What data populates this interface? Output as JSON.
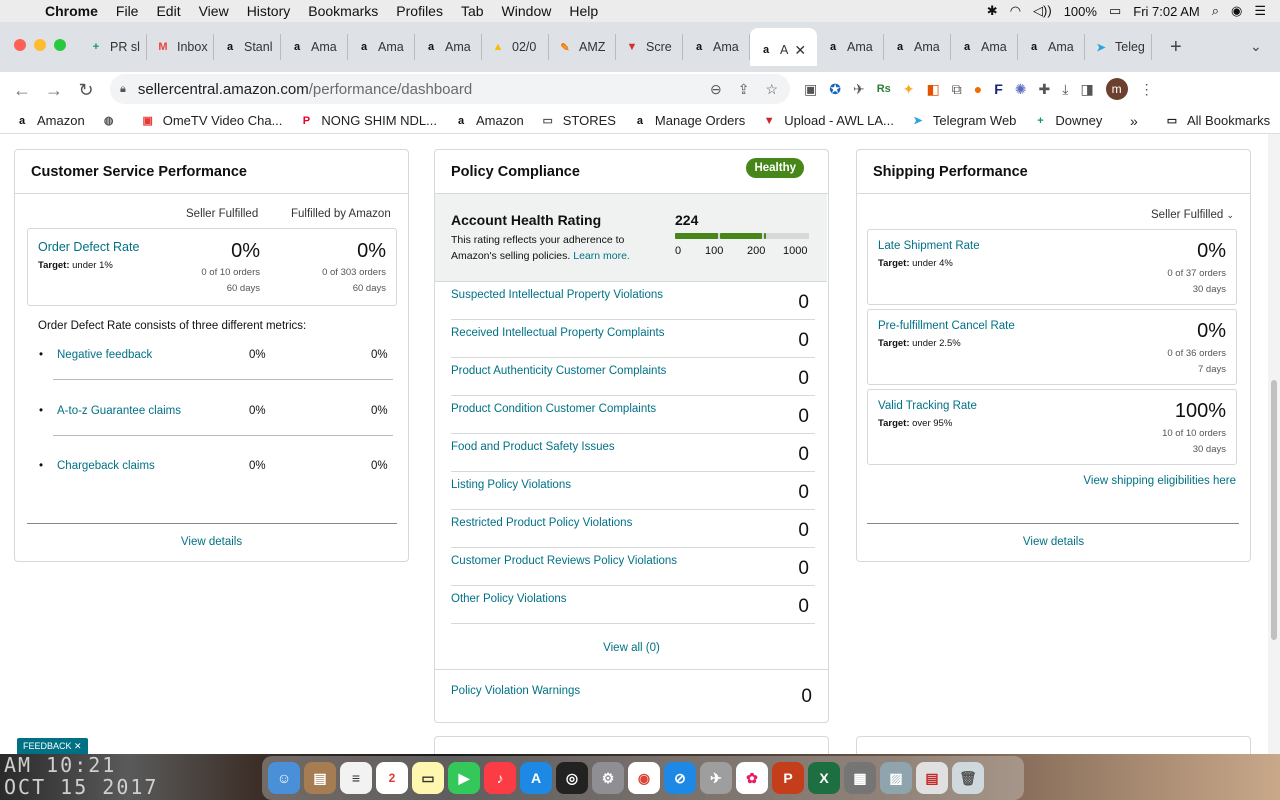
{
  "menubar": {
    "app": "Chrome",
    "items": [
      "File",
      "Edit",
      "View",
      "History",
      "Bookmarks",
      "Profiles",
      "Tab",
      "Window",
      "Help"
    ],
    "battery": "100%",
    "clock": "Fri 7:02 AM"
  },
  "tabs": [
    {
      "label": "PR sl",
      "icon": "sheets-icon",
      "color": "#0f9d58",
      "glyph": "+"
    },
    {
      "label": "Inbox",
      "icon": "gmail-icon",
      "color": "#ea4335",
      "glyph": "M"
    },
    {
      "label": "Stanl",
      "icon": "amazon-icon",
      "color": "#111",
      "glyph": "a"
    },
    {
      "label": "Ama",
      "icon": "amazon-icon",
      "color": "#111",
      "glyph": "a"
    },
    {
      "label": "Ama",
      "icon": "amazon-icon",
      "color": "#111",
      "glyph": "a"
    },
    {
      "label": "Ama",
      "icon": "amazon-icon",
      "color": "#111",
      "glyph": "a"
    },
    {
      "label": "02/0",
      "icon": "drive-icon",
      "color": "#fbbc04",
      "glyph": "▲"
    },
    {
      "label": "AMZ",
      "icon": "pencil-icon",
      "color": "#f57c00",
      "glyph": "✎"
    },
    {
      "label": "Scre",
      "icon": "screen-icon",
      "color": "#d32f2f",
      "glyph": "▼"
    },
    {
      "label": "Ama",
      "icon": "amazon-icon",
      "color": "#111",
      "glyph": "a"
    },
    {
      "label": "A",
      "icon": "amazon-icon",
      "color": "#111",
      "glyph": "a",
      "active": true
    },
    {
      "label": "Ama",
      "icon": "amazon-icon",
      "color": "#111",
      "glyph": "a"
    },
    {
      "label": "Ama",
      "icon": "amazon-icon",
      "color": "#111",
      "glyph": "a"
    },
    {
      "label": "Ama",
      "icon": "amazon-icon",
      "color": "#111",
      "glyph": "a"
    },
    {
      "label": "Ama",
      "icon": "amazon-icon",
      "color": "#111",
      "glyph": "a"
    },
    {
      "label": "Teleg",
      "icon": "telegram-icon",
      "color": "#2aa3df",
      "glyph": "➤"
    }
  ],
  "url": {
    "host": "sellercentral.amazon.com",
    "path": "/performance/dashboard"
  },
  "bookmarks": [
    {
      "label": "Amazon",
      "icon": "amazon-icon"
    },
    {
      "label": "",
      "icon": "globe-icon"
    },
    {
      "label": "OmeTV Video Cha...",
      "icon": "tv-icon"
    },
    {
      "label": "NONG SHIM NDL...",
      "icon": "pinterest-icon"
    },
    {
      "label": "Amazon",
      "icon": "amazon-icon"
    },
    {
      "label": "STORES",
      "icon": "folder-icon"
    },
    {
      "label": "Manage Orders",
      "icon": "amazon-icon"
    },
    {
      "label": "Upload - AWL LA...",
      "icon": "upload-icon"
    },
    {
      "label": "Telegram Web",
      "icon": "telegram-icon"
    },
    {
      "label": "Downey",
      "icon": "sheets-icon"
    }
  ],
  "bookmarks_more": "»",
  "all_bookmarks": "All Bookmarks",
  "customer_service": {
    "title": "Customer Service Performance",
    "col1": "Seller Fulfilled",
    "col2": "Fulfilled by Amazon",
    "odr": {
      "name": "Order Defect Rate",
      "target_label": "Target:",
      "target": "under 1%",
      "sf_pct": "0%",
      "sf_orders": "0 of 10 orders",
      "sf_days": "60 days",
      "fba_pct": "0%",
      "fba_orders": "0 of 303 orders",
      "fba_days": "60 days"
    },
    "consists": "Order Defect Rate consists of three different metrics:",
    "metrics": [
      {
        "name": "Negative feedback",
        "sf": "0%",
        "fba": "0%"
      },
      {
        "name": "A-to-z Guarantee claims",
        "sf": "0%",
        "fba": "0%"
      },
      {
        "name": "Chargeback claims",
        "sf": "0%",
        "fba": "0%"
      }
    ],
    "view_details": "View details"
  },
  "policy": {
    "title": "Policy Compliance",
    "badge": "Healthy",
    "ahr_title": "Account Health Rating",
    "ahr_desc": "This rating reflects your adherence to Amazon's selling policies.",
    "learn_more": "Learn more.",
    "score": "224",
    "score_value": 224,
    "scale": [
      "0",
      "100",
      "200",
      "1000"
    ],
    "rows": [
      {
        "label": "Suspected Intellectual Property Violations",
        "value": "0"
      },
      {
        "label": "Received Intellectual Property Complaints",
        "value": "0"
      },
      {
        "label": "Product Authenticity Customer Complaints",
        "value": "0"
      },
      {
        "label": "Product Condition Customer Complaints",
        "value": "0"
      },
      {
        "label": "Food and Product Safety Issues",
        "value": "0"
      },
      {
        "label": "Listing Policy Violations",
        "value": "0"
      },
      {
        "label": "Restricted Product Policy Violations",
        "value": "0"
      },
      {
        "label": "Customer Product Reviews Policy Violations",
        "value": "0"
      },
      {
        "label": "Other Policy Violations",
        "value": "0"
      }
    ],
    "view_all": "View all (0)",
    "warnings_label": "Policy Violation Warnings",
    "warnings_value": "0"
  },
  "shipping": {
    "title": "Shipping Performance",
    "dropdown": "Seller Fulfilled",
    "metrics": [
      {
        "name": "Late Shipment Rate",
        "target_label": "Target:",
        "target": "under 4%",
        "pct": "0%",
        "orders": "0 of 37 orders",
        "days": "30 days"
      },
      {
        "name": "Pre-fulfillment Cancel Rate",
        "target_label": "Target:",
        "target": "under 2.5%",
        "pct": "0%",
        "orders": "0 of 36 orders",
        "days": "7 days"
      },
      {
        "name": "Valid Tracking Rate",
        "target_label": "Target:",
        "target": "over 95%",
        "pct": "100%",
        "orders": "10 of 10 orders",
        "days": "30 days"
      }
    ],
    "eligibility_link": "View shipping eligibilities here",
    "view_details": "View details"
  },
  "feedback": "FEEDBACK",
  "desktop_text": "AM 10:21\nOCT 15 2017",
  "colors": {
    "link": "#007185",
    "healthy": "#478618",
    "ahr_bar": "#478618"
  }
}
